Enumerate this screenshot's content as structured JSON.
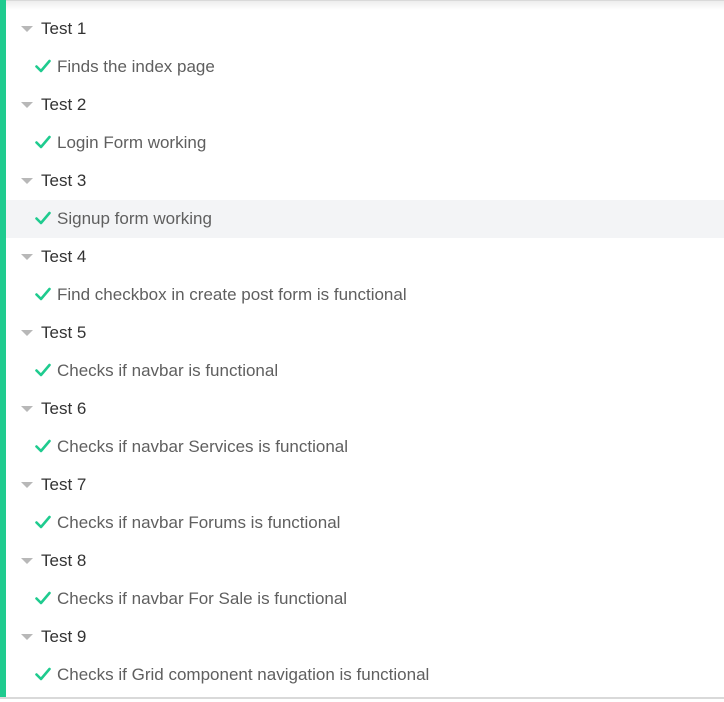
{
  "colors": {
    "accent": "#1fcb8f",
    "pass": "#1fcb8f",
    "caret": "#b8b8b8",
    "highlight_row": "#f3f4f6"
  },
  "icons": {
    "suite": "caret-down-icon",
    "test": "check-icon"
  },
  "suites": [
    {
      "title": "Test 1",
      "tests": [
        {
          "title": "Finds the index page",
          "status": "passed"
        }
      ]
    },
    {
      "title": "Test 2",
      "tests": [
        {
          "title": "Login Form working",
          "status": "passed"
        }
      ]
    },
    {
      "title": "Test 3",
      "tests": [
        {
          "title": "Signup form working",
          "status": "passed",
          "hovered": true
        }
      ]
    },
    {
      "title": "Test 4",
      "tests": [
        {
          "title": "Find checkbox in create post form is functional",
          "status": "passed"
        }
      ]
    },
    {
      "title": "Test 5",
      "tests": [
        {
          "title": "Checks if navbar is functional",
          "status": "passed"
        }
      ]
    },
    {
      "title": "Test 6",
      "tests": [
        {
          "title": "Checks if navbar Services is functional",
          "status": "passed"
        }
      ]
    },
    {
      "title": "Test 7",
      "tests": [
        {
          "title": "Checks if navbar Forums is functional",
          "status": "passed"
        }
      ]
    },
    {
      "title": "Test 8",
      "tests": [
        {
          "title": "Checks if navbar For Sale is functional",
          "status": "passed"
        }
      ]
    },
    {
      "title": "Test 9",
      "tests": [
        {
          "title": "Checks if Grid component navigation is functional",
          "status": "passed"
        }
      ]
    }
  ]
}
